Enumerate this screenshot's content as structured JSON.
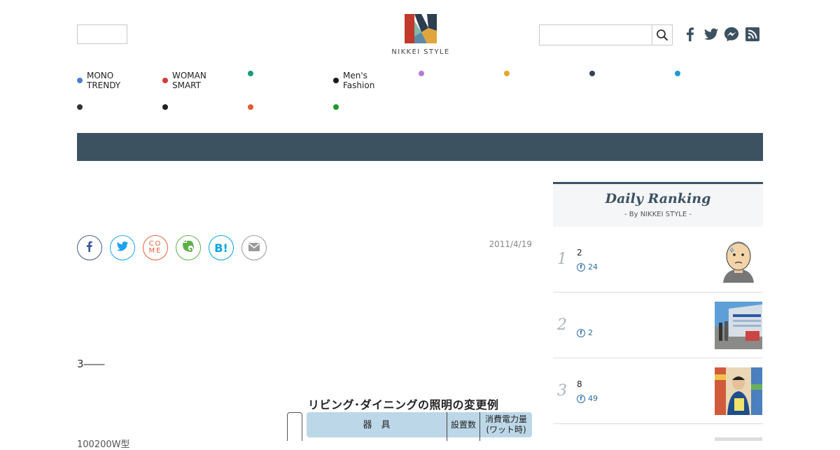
{
  "logo": {
    "text": "NIKKEI STYLE"
  },
  "social_header": [
    {
      "name": "facebook-icon"
    },
    {
      "name": "twitter-icon"
    },
    {
      "name": "messenger-icon"
    },
    {
      "name": "rss-icon"
    }
  ],
  "nav": {
    "row1": [
      {
        "label_line1": "MONO",
        "label_line2": "TRENDY",
        "color": "#4a7fd0"
      },
      {
        "label_line1": "WOMAN",
        "label_line2": "SMART",
        "color": "#d23b3b"
      },
      {
        "label_line1": "",
        "label_line2": "",
        "color": "#1a9a7a"
      },
      {
        "label_line1": "Men's",
        "label_line2": "Fashion",
        "color": "#1a1a1a"
      },
      {
        "label_line1": "",
        "label_line2": "",
        "color": "#b77ad8"
      },
      {
        "label_line1": "",
        "label_line2": "",
        "color": "#dfa92a"
      },
      {
        "label_line1": "",
        "label_line2": "",
        "color": "#33415e"
      },
      {
        "label_line1": "",
        "label_line2": "",
        "color": "#1f9ad6"
      }
    ],
    "row2": [
      {
        "label_line1": "",
        "label_line2": "",
        "color": "#333333"
      },
      {
        "label_line1": "",
        "label_line2": "",
        "color": "#222222"
      },
      {
        "label_line1": "",
        "label_line2": "",
        "color": "#e25c33"
      },
      {
        "label_line1": "",
        "label_line2": "",
        "color": "#1a9a2a"
      }
    ]
  },
  "article": {
    "date": "2011/4/19",
    "body_line": "3――",
    "cut_line": "100200W型",
    "figure": {
      "title": "リビング･ダイニングの照明の変更例",
      "col_fixture": "器　具",
      "col_count": "設置数",
      "col_power_line1": "消費電力量",
      "col_power_line2": "(ワット時)"
    }
  },
  "share": [
    {
      "name": "facebook-share-button",
      "glyph": "f",
      "color": "#3b5998"
    },
    {
      "name": "twitter-share-button",
      "glyph": "t",
      "color": "#1da1f2"
    },
    {
      "name": "comemo-share-button",
      "glyph": "CO\nME",
      "color": "#e0633c"
    },
    {
      "name": "evernote-share-button",
      "glyph": "e",
      "color": "#5fb04a"
    },
    {
      "name": "hatena-share-button",
      "glyph": "B!",
      "color": "#00a4de"
    },
    {
      "name": "mail-share-button",
      "glyph": "m",
      "color": "#999999"
    }
  ],
  "ranking": {
    "title": "Daily Ranking",
    "subtitle": "- By NIKKEI STYLE -",
    "items": [
      {
        "rank": "1",
        "text": "2",
        "fb": "24"
      },
      {
        "rank": "2",
        "text": "",
        "fb": "2"
      },
      {
        "rank": "3",
        "text": "8",
        "fb": "49"
      }
    ]
  }
}
